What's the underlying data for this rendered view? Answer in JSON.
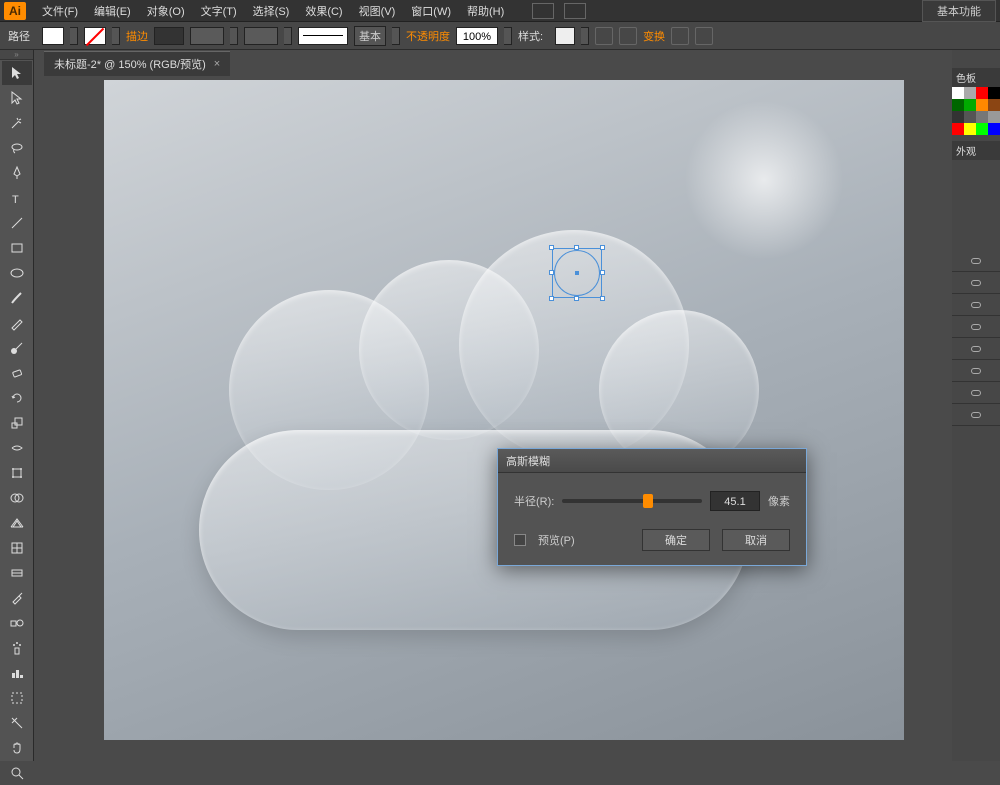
{
  "app": {
    "logo": "Ai"
  },
  "menu": {
    "items": [
      "文件(F)",
      "编辑(E)",
      "对象(O)",
      "文字(T)",
      "选择(S)",
      "效果(C)",
      "视图(V)",
      "窗口(W)",
      "帮助(H)"
    ],
    "workspace": "基本功能"
  },
  "control": {
    "pathLabel": "路径",
    "strokeLabel": "描边",
    "profileLabel": "基本",
    "opacityLabel": "不透明度",
    "opacityValue": "100%",
    "styleLabel": "样式:",
    "transformLabel": "变换"
  },
  "document": {
    "tabTitle": "未标题-2* @ 150% (RGB/预览)",
    "closeGlyph": "×"
  },
  "dialog": {
    "title": "高斯模糊",
    "radiusLabel": "半径(R):",
    "radiusValue": "45.1",
    "unit": "像素",
    "previewLabel": "预览(P)",
    "okLabel": "确定",
    "cancelLabel": "取消"
  },
  "panels": {
    "swatchesTitle": "色板",
    "appearanceTitle": "外观",
    "swatchColors": [
      "#ffffff",
      "#aaaaaa",
      "#ff0000",
      "#000000",
      "#006600",
      "#00aa00",
      "#ff8800",
      "#8b4513",
      "#333333",
      "#555555",
      "#777777",
      "#999999",
      "#ff0000",
      "#ffff00",
      "#00ff00",
      "#0000ff"
    ]
  }
}
